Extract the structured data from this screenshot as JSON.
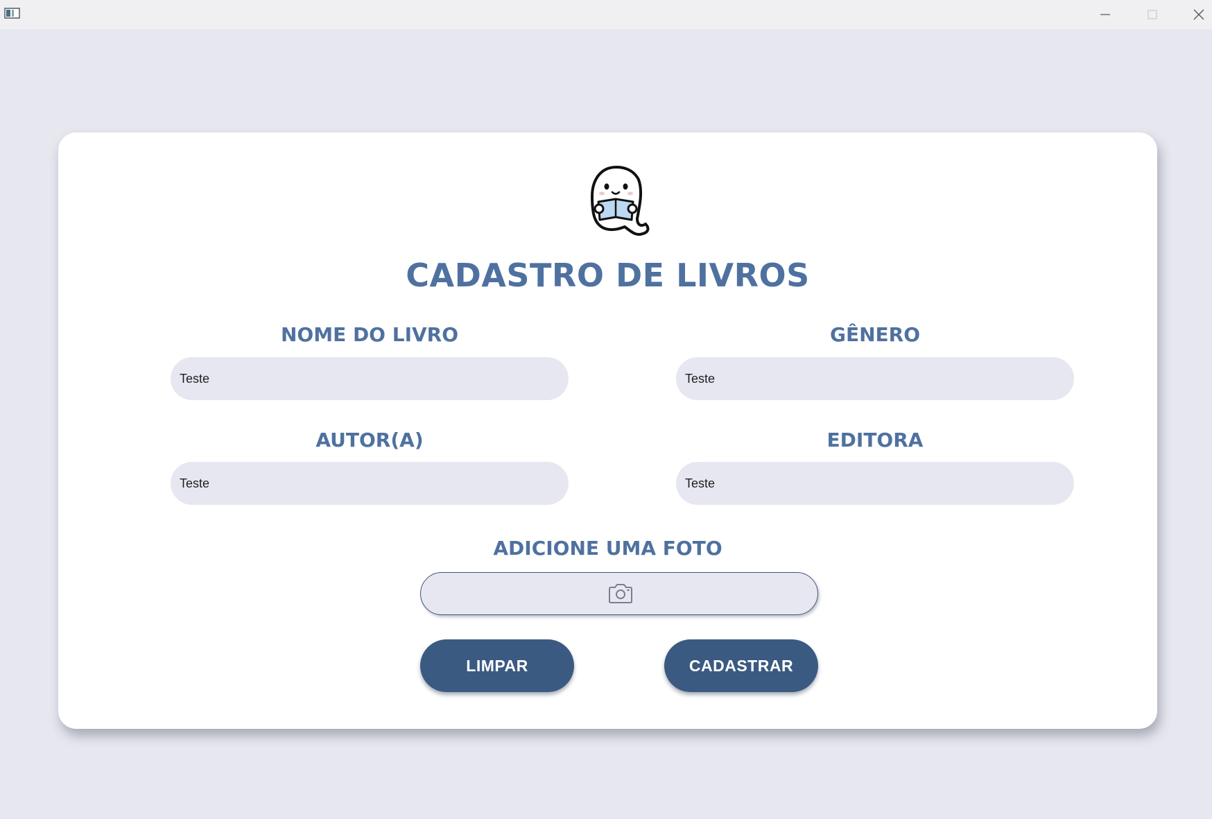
{
  "window": {
    "title": "",
    "controls": [
      "minimize-icon",
      "maximize-icon",
      "close-icon"
    ]
  },
  "form": {
    "title": "CADASTRO DE LIVROS",
    "logo_icon": "ghost-reading-book-icon",
    "fields": {
      "book_name": {
        "label": "NOME DO LIVRO",
        "value": "Teste"
      },
      "genre": {
        "label": "GÊNERO",
        "value": "Teste"
      },
      "author": {
        "label": "AUTOR(A)",
        "value": "Teste"
      },
      "publisher": {
        "label": "EDITORA",
        "value": "Teste"
      }
    },
    "photo": {
      "label": "ADICIONE UMA FOTO",
      "icon": "camera-icon"
    },
    "buttons": {
      "clear": "LIMPAR",
      "submit": "CADASTRAR"
    }
  },
  "colors": {
    "background": "#e6e7ef",
    "accent_text": "#4f71a0",
    "button": "#3b5a82",
    "input_fill": "#e6e7f0"
  }
}
